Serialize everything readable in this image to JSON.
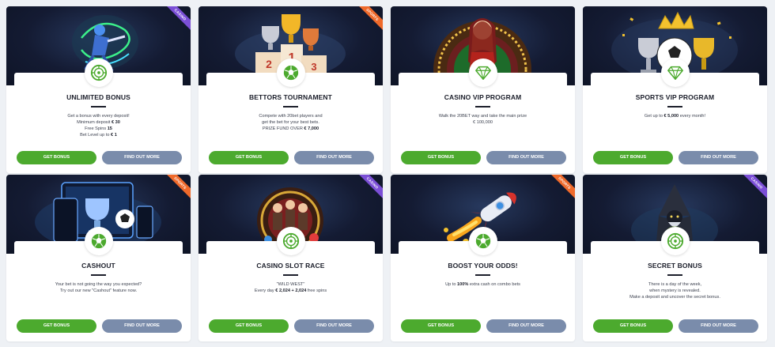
{
  "colors": {
    "green": "#4caa2e",
    "slate": "#7a8cab",
    "casino_tag": "#7b4fd6",
    "sports_tag": "#ef6a2b",
    "hero_bg": "#141b33"
  },
  "cards": [
    {
      "tag": "CASINO",
      "tag_type": "casino",
      "icon": "roulette-icon",
      "title": "UNLIMITED BONUS",
      "lines": [
        {
          "t": "Get a bonus with every deposit!"
        },
        {
          "t": "Minimum deposit ",
          "b": "€ 30"
        },
        {
          "t": "Free Spins ",
          "b": "15"
        },
        {
          "t": "Bet Level up to ",
          "b": "€ 1"
        }
      ],
      "get_label": "GET BONUS",
      "more_label": "FIND OUT MORE",
      "art": "neon-dancer"
    },
    {
      "tag": "SPORTS",
      "tag_type": "sports",
      "icon": "soccer-ball-icon",
      "title": "BETTORS TOURNAMENT",
      "lines": [
        {
          "t": "Compete with 20bet players and"
        },
        {
          "t": "get the bet for your best bets."
        },
        {
          "t": "PRIZE FUND OVER ",
          "b": "€ 7,000"
        }
      ],
      "get_label": "GET BONUS",
      "more_label": "FIND OUT MORE",
      "art": "trophy-podium",
      "podium": [
        "2",
        "1",
        "3"
      ]
    },
    {
      "tag": "",
      "tag_type": "",
      "icon": "diamond-icon",
      "title": "CASINO VIP PROGRAM",
      "lines": [
        {
          "t": "Walk the 20BET way and take the main prize"
        },
        {
          "t": "€ 100,000"
        }
      ],
      "get_label": "GET BONUS",
      "more_label": "FIND OUT MORE",
      "art": "roulette-lady"
    },
    {
      "tag": "",
      "tag_type": "",
      "icon": "diamond-icon",
      "title": "SPORTS VIP PROGRAM",
      "lines": [
        {
          "t": "Get up to ",
          "b": "€ 5,000",
          "a": " every month!"
        }
      ],
      "get_label": "GET BONUS",
      "more_label": "FIND OUT MORE",
      "art": "crown-trophies"
    },
    {
      "tag": "SPORTS",
      "tag_type": "sports",
      "icon": "soccer-ball-icon",
      "title": "CASHOUT",
      "lines": [
        {
          "t": "Your bet is not going the way you expected?"
        },
        {
          "t": "Try out our new \"Cashout\" feature now."
        }
      ],
      "get_label": "GET BONUS",
      "more_label": "FIND OUT MORE",
      "art": "devices-trophy"
    },
    {
      "tag": "CASINO",
      "tag_type": "casino",
      "icon": "roulette-icon",
      "title": "CASINO SLOT RACE",
      "lines": [
        {
          "t": "\"WILD WEST\""
        },
        {
          "t": "Every day ",
          "b": "€ 2,024 + 2,024",
          "a": " free spins"
        }
      ],
      "get_label": "GET BONUS",
      "more_label": "FIND OUT MORE",
      "art": "slot-wheel"
    },
    {
      "tag": "SPORTS",
      "tag_type": "sports",
      "icon": "soccer-ball-icon",
      "title": "BOOST YOUR ODDS!",
      "lines": [
        {
          "t": "Up to ",
          "b": "100%",
          "a": " extra cash on combo bets"
        }
      ],
      "get_label": "GET BONUS",
      "more_label": "FIND OUT MORE",
      "art": "rocket"
    },
    {
      "tag": "CASINO",
      "tag_type": "casino",
      "icon": "roulette-icon",
      "title": "SECRET BONUS",
      "lines": [
        {
          "t": "There is a day of the week,"
        },
        {
          "t": "when mystery is revealed."
        },
        {
          "t": "Make a deposit and uncover the secret bonus."
        }
      ],
      "get_label": "GET BONUS",
      "more_label": "FIND OUT MORE",
      "art": "wizard"
    }
  ]
}
